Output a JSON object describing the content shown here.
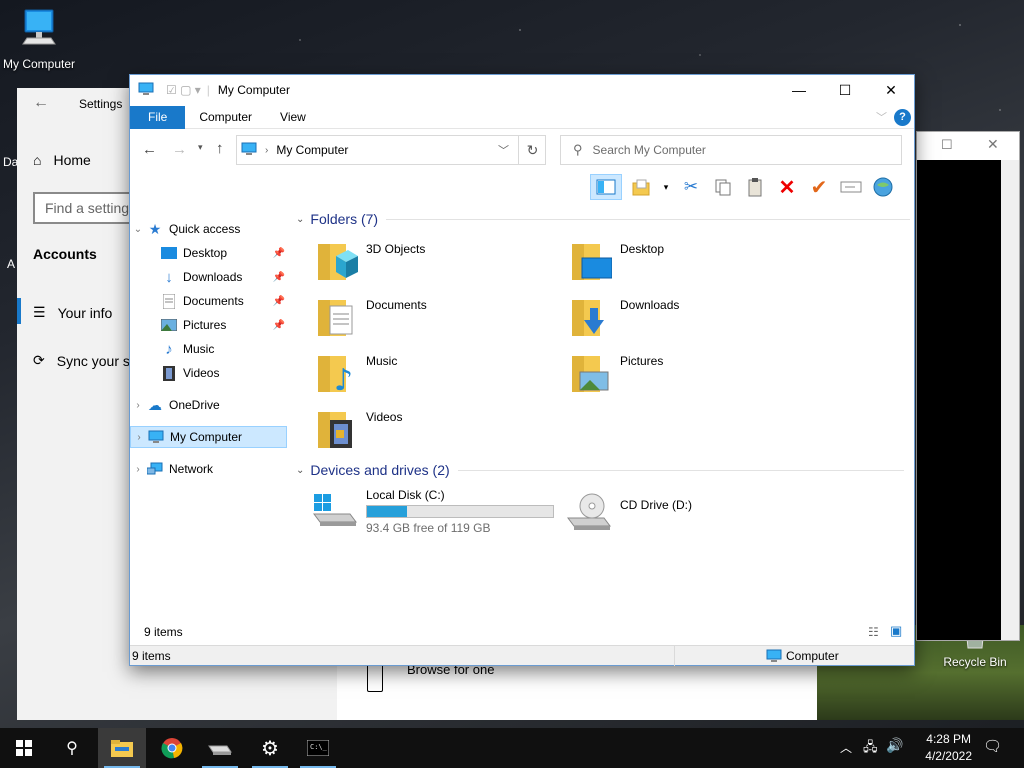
{
  "desktop": {
    "icons": [
      {
        "label": "My Computer"
      },
      {
        "label": "Recycle Bin"
      }
    ],
    "fragments": {
      "da": "Da",
      "a": "A"
    }
  },
  "settings_window": {
    "title": "Settings",
    "home": "Home",
    "search_placeholder": "Find a setting",
    "section": "Accounts",
    "items": [
      "Your info",
      "Sync your s"
    ],
    "bottom_text": "Browse for one"
  },
  "explorer": {
    "title": "My Computer",
    "tabs": [
      "File",
      "Computer",
      "View"
    ],
    "address": "My Computer",
    "search_placeholder": "Search My Computer",
    "nav": {
      "quick_access": "Quick access",
      "quick_items": [
        "Desktop",
        "Downloads",
        "Documents",
        "Pictures",
        "Music",
        "Videos"
      ],
      "onedrive": "OneDrive",
      "my_computer": "My Computer",
      "network": "Network"
    },
    "folders_header": "Folders (7)",
    "folders": [
      "3D Objects",
      "Desktop",
      "Documents",
      "Downloads",
      "Music",
      "Pictures",
      "Videos"
    ],
    "drives_header": "Devices and drives (2)",
    "drives": [
      {
        "name": "Local Disk (C:)",
        "free": "93.4 GB free of 119 GB",
        "used_fraction": 0.215
      },
      {
        "name": "CD Drive (D:)"
      }
    ],
    "item_count": "9 items",
    "status_count": "9 items",
    "status_location": "Computer"
  },
  "taskbar": {
    "time": "4:28 PM",
    "date": "4/2/2022"
  },
  "colors": {
    "accent": "#1979ca",
    "selection": "#cce8ff",
    "folder": "#f4c94f",
    "progress": "#26a0da"
  }
}
